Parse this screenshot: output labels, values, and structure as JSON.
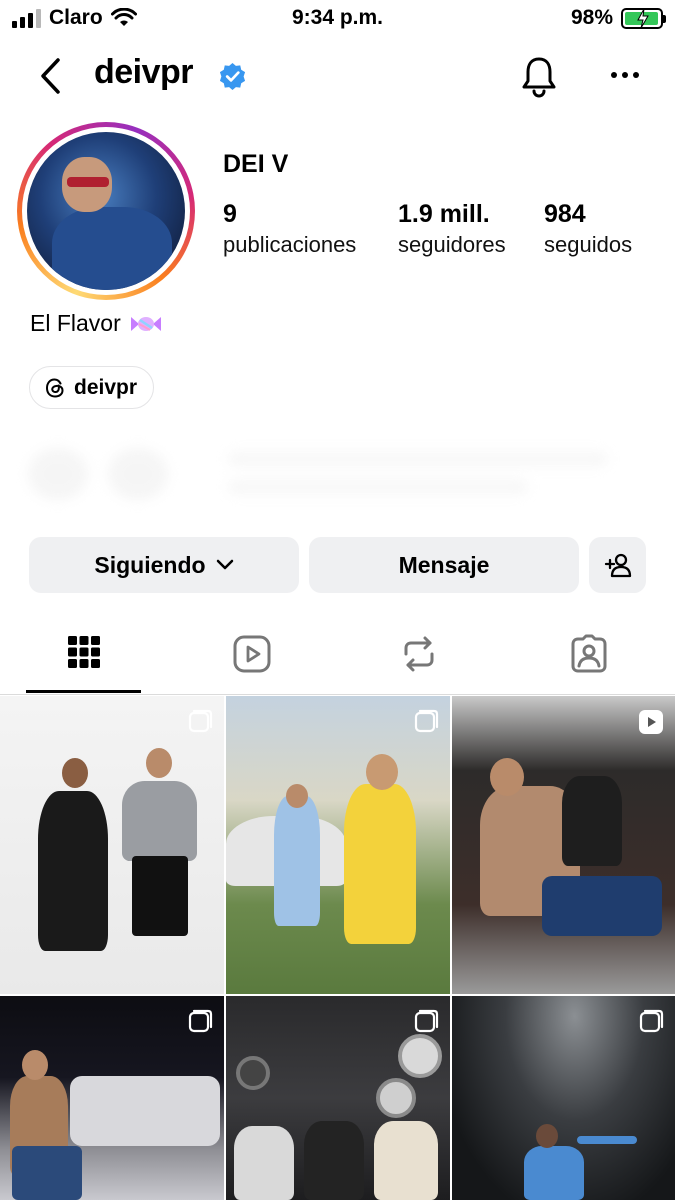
{
  "status_bar": {
    "carrier": "Claro",
    "time": "9:34 p.m.",
    "battery": "98%",
    "battery_level": 0.98
  },
  "header": {
    "username": "deivpr",
    "verified": true
  },
  "profile": {
    "display_name": "DEI V",
    "stats": [
      {
        "value": "9",
        "label": "publicaciones"
      },
      {
        "value": "1.9 mill.",
        "label": "seguidores"
      },
      {
        "value": "984",
        "label": "seguidos"
      }
    ],
    "bio": "El Flavor",
    "threads_handle": "deivpr"
  },
  "actions": {
    "following_label": "Siguiendo",
    "message_label": "Mensaje"
  },
  "tabs": [
    {
      "name": "posts",
      "icon": "grid-icon",
      "active": true
    },
    {
      "name": "reels",
      "icon": "reels-icon",
      "active": false
    },
    {
      "name": "reposts",
      "icon": "repost-icon",
      "active": false
    },
    {
      "name": "tagged",
      "icon": "tagged-icon",
      "active": false
    }
  ],
  "posts": [
    {
      "type": "carousel"
    },
    {
      "type": "carousel"
    },
    {
      "type": "reel"
    },
    {
      "type": "carousel"
    },
    {
      "type": "carousel"
    },
    {
      "type": "carousel"
    }
  ],
  "colors": {
    "verified_blue": "#3897f0",
    "button_bg": "#eff0f2",
    "battery_green": "#34c759",
    "ring_start": "#feda75",
    "ring_mid": "#d62976",
    "ring_end": "#962fbf"
  }
}
